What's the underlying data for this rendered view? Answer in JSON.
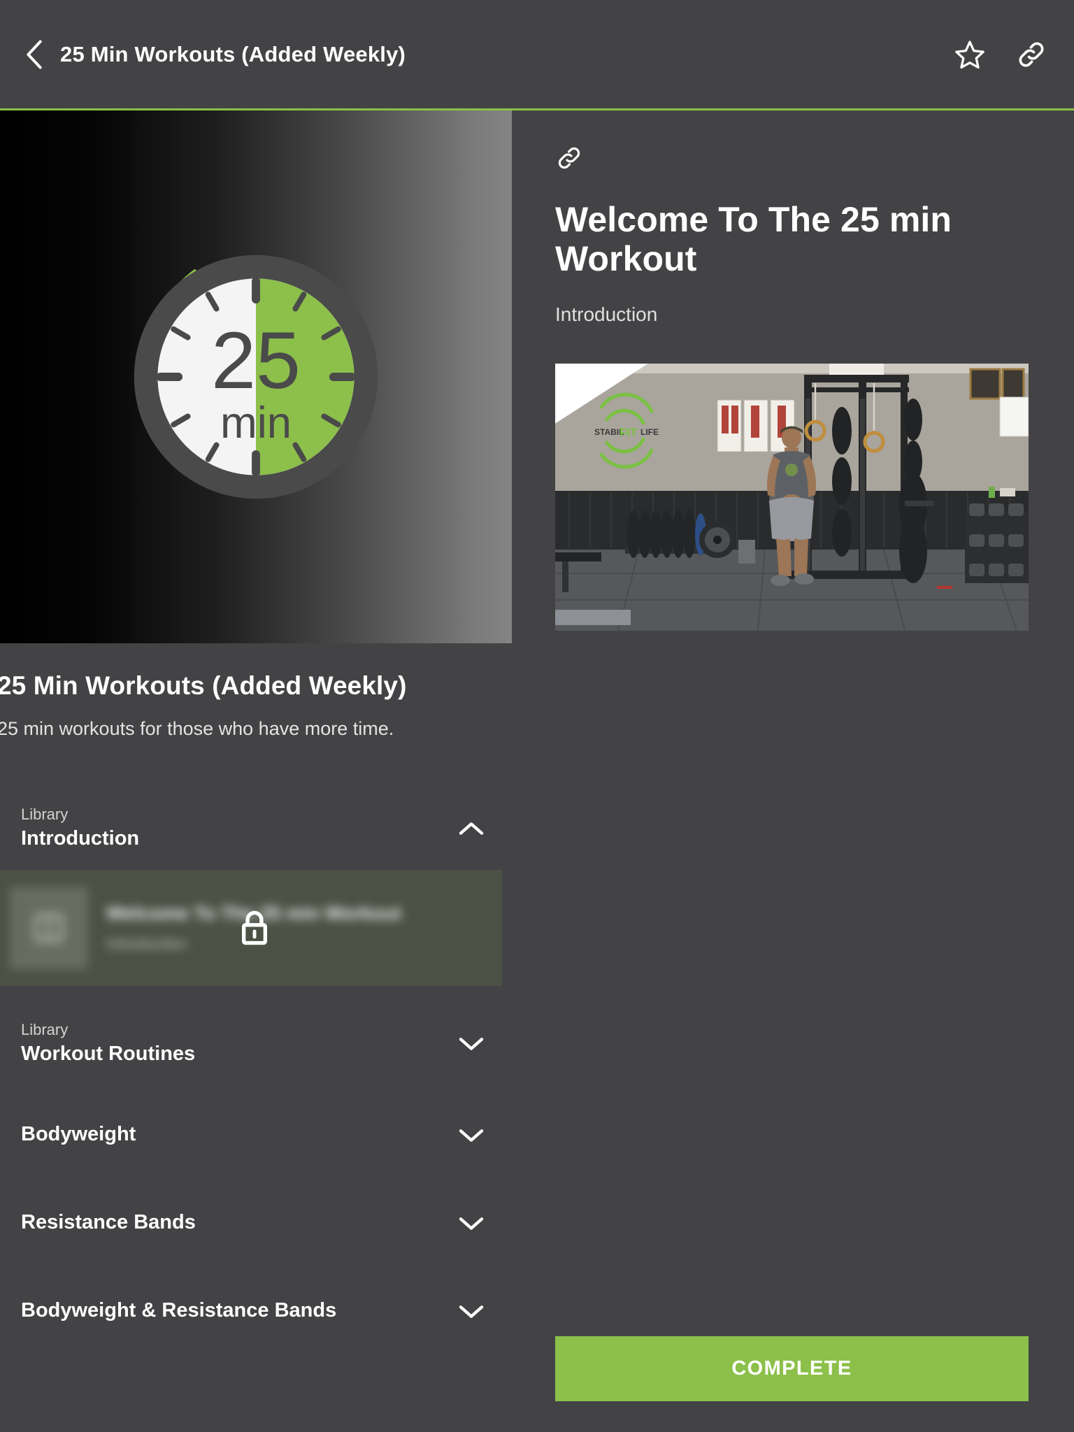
{
  "theme": {
    "background": "#434345",
    "accent_green": "#8CC04A",
    "text_primary": "#FFFFFF",
    "text_secondary": "#D2D2D2",
    "locked_row_bg": "#4B5145"
  },
  "topbar": {
    "back_icon": "chevron-left-icon",
    "title": "25 Min Workouts (Added Weekly)",
    "actions": [
      {
        "icon": "star-icon",
        "name": "favorite-button"
      },
      {
        "icon": "link-icon",
        "name": "share-link-button"
      }
    ]
  },
  "course": {
    "hero_image_alt": "25 min stopwatch graphic",
    "hero_timer_value": "25",
    "hero_timer_unit": "min",
    "title": "25 Min Workouts (Added Weekly)",
    "description": "25 min workouts for those who have more time."
  },
  "sections": [
    {
      "eyebrow": "Library",
      "name": "Introduction",
      "expanded": true,
      "chevron": "chevron-up-icon",
      "lessons": [
        {
          "title": "Welcome To The 25 min Workout",
          "subtitle": "Introduction",
          "locked": true,
          "lock_icon": "lock-icon",
          "thumb_icon": "book-icon"
        }
      ]
    },
    {
      "eyebrow": "Library",
      "name": "Workout Routines",
      "expanded": false,
      "chevron": "chevron-down-icon",
      "lessons": []
    },
    {
      "eyebrow": "",
      "name": "Bodyweight",
      "expanded": false,
      "chevron": "chevron-down-icon",
      "lessons": []
    },
    {
      "eyebrow": "",
      "name": "Resistance Bands",
      "expanded": false,
      "chevron": "chevron-down-icon",
      "lessons": []
    },
    {
      "eyebrow": "",
      "name": "Bodyweight & Resistance Bands",
      "expanded": false,
      "chevron": "chevron-down-icon",
      "lessons": []
    }
  ],
  "lesson": {
    "link_icon": "link-icon",
    "title": "Welcome To The 25 min Workout",
    "subtitle": "Introduction",
    "video": {
      "play_icon": "play-icon",
      "alt": "Trainer standing in home gym in front of power rack",
      "wall_logo_text_1": "STABIL",
      "wall_logo_text_2": "FIT",
      "wall_logo_text_3": "LIFE"
    },
    "complete_label": "COMPLETE"
  }
}
